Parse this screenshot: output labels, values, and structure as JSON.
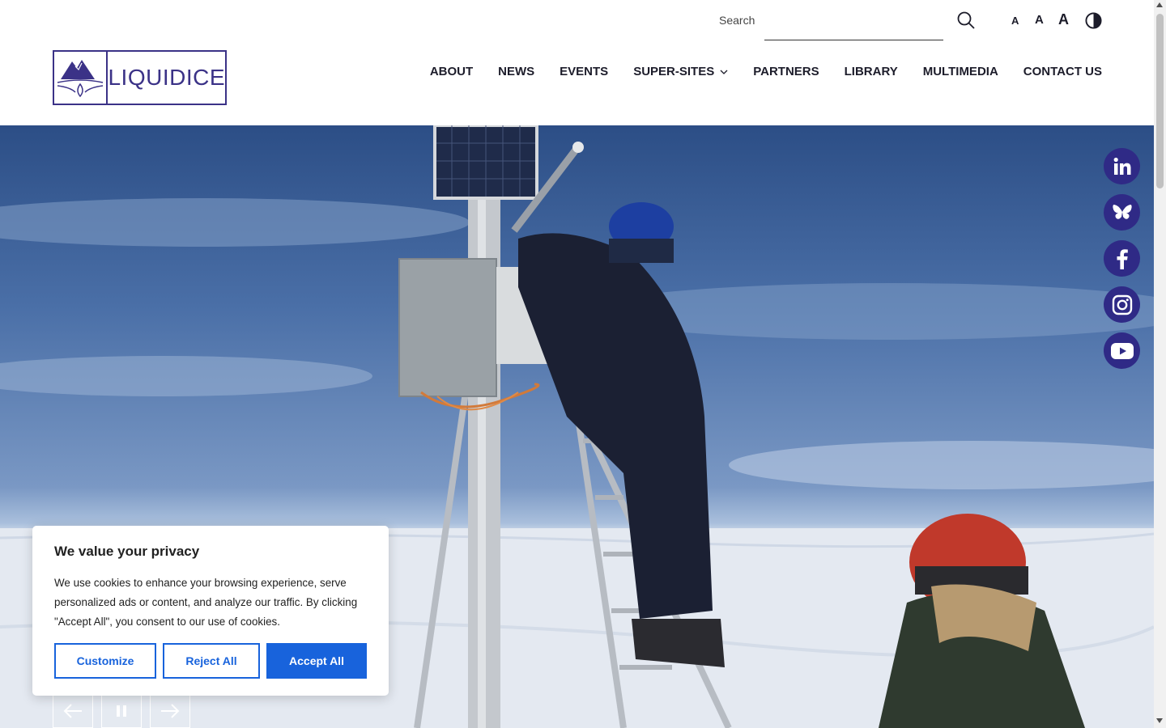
{
  "header": {
    "search": {
      "label": "Search",
      "placeholder": ""
    },
    "font_size_controls": [
      "A",
      "A",
      "A"
    ],
    "logo_text": "LIQUIDICE"
  },
  "nav": {
    "items": [
      {
        "label": "ABOUT"
      },
      {
        "label": "NEWS"
      },
      {
        "label": "EVENTS"
      },
      {
        "label": "SUPER-SITES",
        "has_dropdown": true
      },
      {
        "label": "PARTNERS"
      },
      {
        "label": "LIBRARY"
      },
      {
        "label": "MULTIMEDIA"
      },
      {
        "label": "CONTACT US"
      }
    ]
  },
  "social": [
    "linkedin-icon",
    "bluesky-icon",
    "facebook-icon",
    "instagram-icon",
    "youtube-icon"
  ],
  "slider": {
    "controls": [
      "previous-arrow-icon",
      "pause-icon",
      "next-arrow-icon"
    ]
  },
  "cookie": {
    "title": "We value your privacy",
    "text": "We use cookies to enhance your browsing experience, serve personalized ads or content, and analyze our traffic. By clicking \"Accept All\", you consent to our use of cookies.",
    "customize": "Customize",
    "reject": "Reject All",
    "accept": "Accept All"
  },
  "colors": {
    "brand": "#2f2a86",
    "accent": "#1863dc"
  }
}
